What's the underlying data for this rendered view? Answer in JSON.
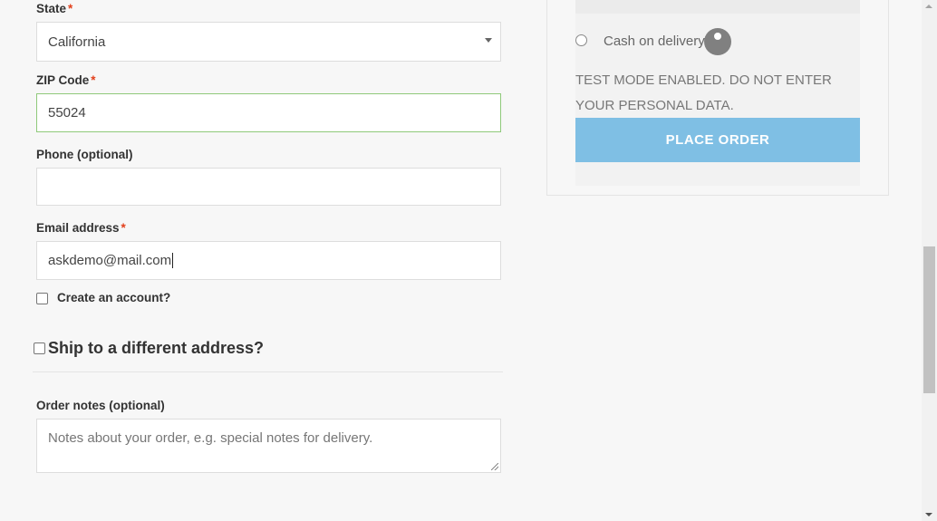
{
  "billing": {
    "state": {
      "label": "State",
      "required": "*",
      "value": "California"
    },
    "zip": {
      "label": "ZIP Code",
      "required": "*",
      "value": "55024"
    },
    "phone": {
      "label": "Phone (optional)",
      "value": ""
    },
    "email": {
      "label": "Email address",
      "required": "*",
      "value": "askdemo@mail.com"
    },
    "create_account": {
      "label": "Create an account?",
      "checked": false
    }
  },
  "shipping": {
    "ship_different_label": "Ship to a different address?",
    "checked": false
  },
  "order_notes": {
    "label": "Order notes (optional)",
    "placeholder": "Notes about your order, e.g. special notes for delivery."
  },
  "payment": {
    "cash_on_delivery_label": "Cash on delivery",
    "test_mode_notice": "TEST MODE ENABLED. DO NOT ENTER YOUR PERSONAL DATA.",
    "place_order_label": "PLACE ORDER"
  },
  "colors": {
    "required_star": "#e2401c",
    "valid_border": "#8fc97a",
    "place_order_bg": "#7fbfe4"
  }
}
